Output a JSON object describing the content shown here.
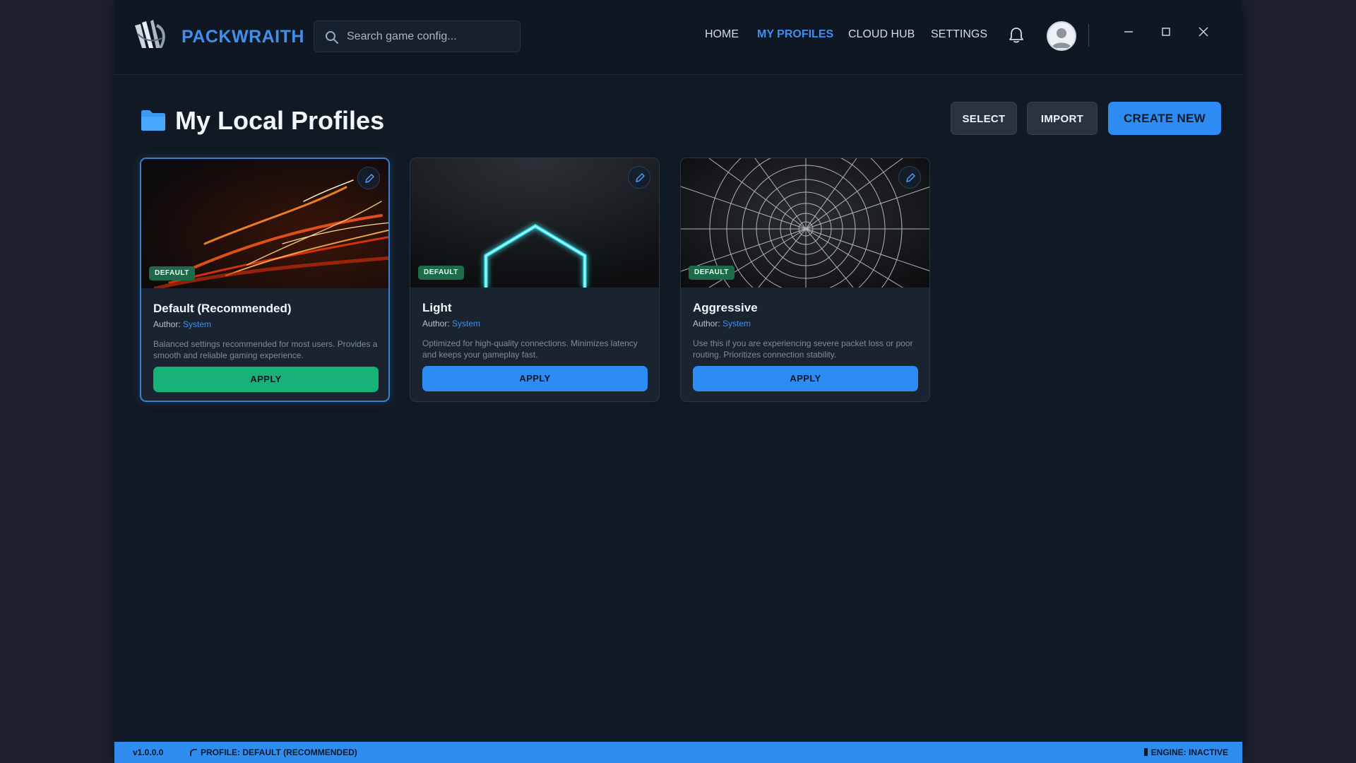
{
  "app": {
    "name": "PACKWRAITH",
    "search_placeholder": "Search game config...",
    "nav": [
      {
        "label": "HOME",
        "active": false
      },
      {
        "label": "MY PROFILES",
        "active": true
      },
      {
        "label": "CLOUD HUB",
        "active": false
      },
      {
        "label": "SETTINGS",
        "active": false
      }
    ],
    "icons": {
      "logo": "wolf-claw-logo",
      "search": "search-icon",
      "notifications": "bell-icon",
      "avatar": "user-avatar-icon",
      "minimize": "minimize-icon",
      "maximize": "maximize-icon",
      "close": "close-icon"
    }
  },
  "header": {
    "title": "My Local Profiles",
    "icon": "folder-icon",
    "select_label": "SELECT",
    "import_label": "IMPORT",
    "create_label": "CREATE NEW"
  },
  "profiles": [
    {
      "title": "Default (Recommended)",
      "badge": "DEFAULT",
      "author_label": "Author:",
      "author": "System",
      "description": "Balanced settings recommended for most users. Provides a smooth and reliable gaming experience.",
      "apply_label": "APPLY",
      "selected": true,
      "image": "light-streaks"
    },
    {
      "title": "Light",
      "badge": "DEFAULT",
      "author_label": "Author:",
      "author": "System",
      "description": "Optimized for high-quality connections. Minimizes latency and keeps your gameplay fast.",
      "apply_label": "APPLY",
      "selected": false,
      "image": "neon-hexagon"
    },
    {
      "title": "Aggressive",
      "badge": "DEFAULT",
      "author_label": "Author:",
      "author": "System",
      "description": "Use this if you are experiencing severe packet loss or poor routing. Prioritizes connection stability.",
      "apply_label": "APPLY",
      "selected": false,
      "image": "spider-web"
    }
  ],
  "status": {
    "version": "v1.0.0.0",
    "profile": "PROFILE: DEFAULT (RECOMMENDED)",
    "engine": "ENGINE: INACTIVE"
  },
  "colors": {
    "accent": "#2d8cf3",
    "apply_selected": "#17b27a",
    "badge": "#1d6b49",
    "background": "#111a24"
  }
}
